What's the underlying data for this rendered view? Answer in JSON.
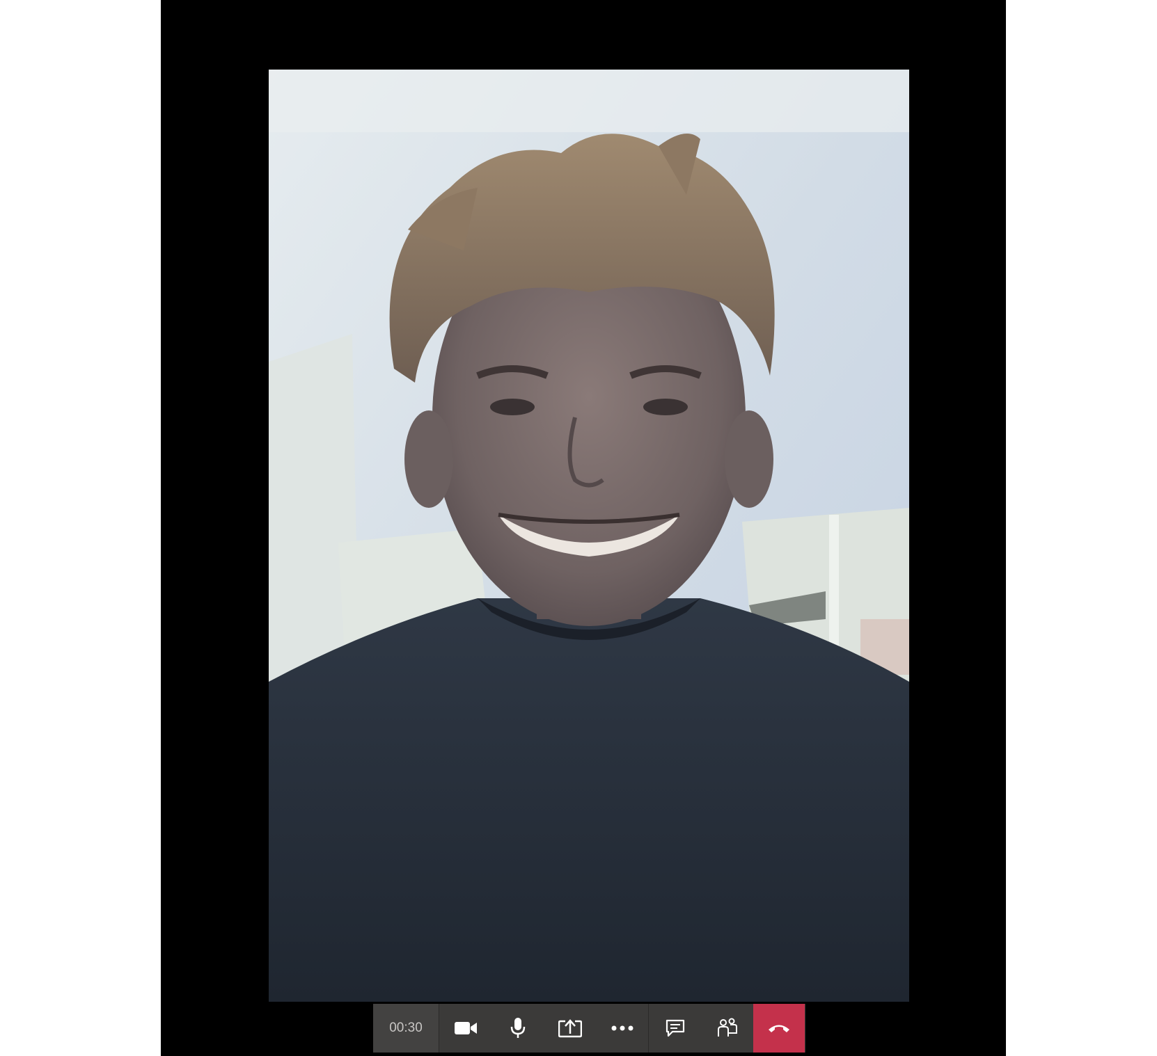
{
  "call": {
    "timer": "00:30"
  },
  "video": {
    "participant_feed": "participant-video"
  },
  "toolbar": {
    "buttons": [
      {
        "name": "camera-button",
        "icon": "video-camera-icon"
      },
      {
        "name": "microphone-button",
        "icon": "microphone-icon"
      },
      {
        "name": "share-screen-button",
        "icon": "share-tray-icon"
      },
      {
        "name": "more-actions-button",
        "icon": "ellipsis-icon"
      },
      {
        "name": "chat-button",
        "icon": "chat-icon"
      },
      {
        "name": "participants-button",
        "icon": "people-icon"
      },
      {
        "name": "hang-up-button",
        "icon": "hang-up-phone-icon"
      }
    ]
  },
  "colors": {
    "background": "#000000",
    "toolbar": "#3b3a39",
    "timer_bg": "#434241",
    "hang_up": "#c4314b",
    "icon": "#ffffff"
  }
}
